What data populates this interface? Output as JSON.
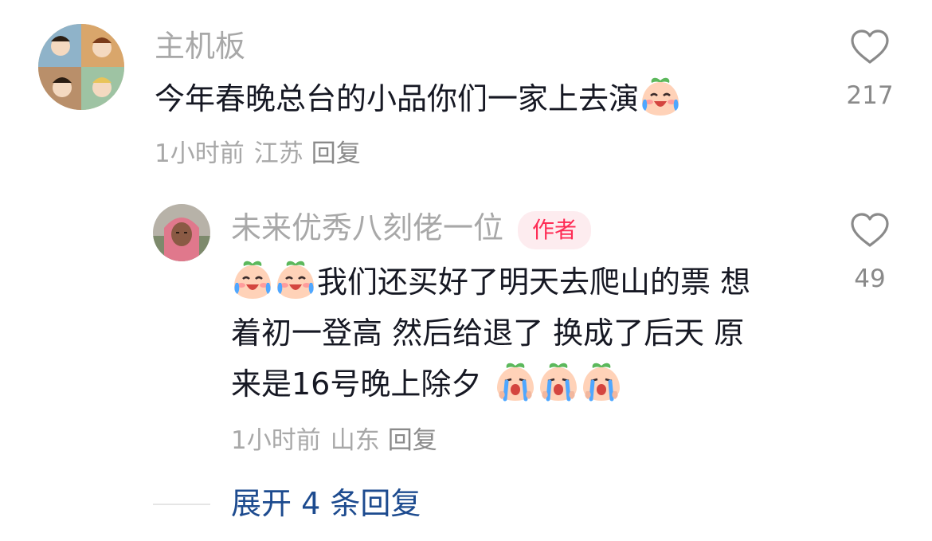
{
  "comment": {
    "username": "主机板",
    "text": "今年春晚总台的小品你们一家上去演",
    "emoji_end": "crying-laughing-peach-emoji",
    "time": "1小时前",
    "location": "江苏",
    "reply_label": "回复",
    "likes": "217"
  },
  "reply": {
    "username": "未来优秀八刻佬一位",
    "author_tag": "作者",
    "line1": "我们还买好了明天去爬山的票 想",
    "line2": "着初一登高 然后给退了 换成了后天 原",
    "line3": "来是16号晚上除夕",
    "emoji_start": "crying-laughing-peach-emoji",
    "emoji_end": "wailing-peach-emoji",
    "time": "1小时前",
    "location": "山东",
    "reply_label": "回复",
    "likes": "49"
  },
  "expand": {
    "label": "展开 4 条回复"
  },
  "colors": {
    "accent_red": "#fe2c55",
    "link_blue": "#1d4b8f",
    "muted_gray": "#a8a8a8",
    "text_dark": "#161823"
  }
}
